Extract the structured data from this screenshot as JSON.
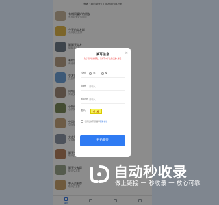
{
  "app": {
    "header": "有客 · 我的聊天 | TheAndroid.me"
  },
  "chats": [
    {
      "name": "有相同爱好的朋友",
      "preview": "有相同爱好的朋友",
      "color": "#c9b79d"
    },
    {
      "name": "今天的交友群",
      "preview": "今天的交友群",
      "color": "#e2b84b"
    },
    {
      "name": "聊聊天交友",
      "preview": "聊聊天交友",
      "color": "#6f7c89"
    },
    {
      "name": "有缘来相见",
      "preview": "有缘来相见",
      "color": "#b8a088"
    },
    {
      "name": "交友同城",
      "preview": "交友同城",
      "color": "#6fa3d9"
    },
    {
      "name": "同城交友群",
      "preview": "同城交友群",
      "color": "#a38d7c"
    },
    {
      "name": "心情驿站",
      "preview": "心情驿站",
      "color": "#7d8a5c"
    },
    {
      "name": "空闲来聊天",
      "preview": "空闲来聊天",
      "color": "#c7a67e"
    },
    {
      "name": "交友聊天",
      "preview": "交友聊天",
      "color": "#8c96a6"
    },
    {
      "name": "聊天交友",
      "preview": "聊天交友",
      "color": "#b7825f"
    },
    {
      "name": "聊天交友群",
      "preview": "聊天交友群",
      "color": "#9ba68d"
    },
    {
      "name": "聊天交友群",
      "preview": "聊天交友群",
      "color": "#caa46f"
    }
  ],
  "tabs": [
    {
      "label": "消息",
      "active": true
    },
    {
      "label": "",
      "active": false
    },
    {
      "label": "",
      "active": false
    },
    {
      "label": "",
      "active": false
    }
  ],
  "modal": {
    "title": "填写信息",
    "close": "×",
    "notice": "为了保护您的隐私，请填写以下信息后进入聊天",
    "gender_label": "性别",
    "gender_male": "男",
    "gender_female": "女",
    "age_label": "年龄",
    "age_placeholder": "请输入",
    "code_label": "验证码",
    "code_placeholder": "请输入",
    "pic_label": "图片",
    "captcha_text": "4 9",
    "agree_text": "请阅读并同意遵守",
    "agree_link": "服务协议",
    "submit": "开始聊天"
  },
  "watermark": {
    "title": "自动秒收录",
    "subtitle": "做上链接 一 秒收录 一 放心可靠"
  },
  "colors": {
    "accent": "#2f7bf3",
    "notice": "#e33333",
    "captcha_bg": "#f6f35a"
  }
}
